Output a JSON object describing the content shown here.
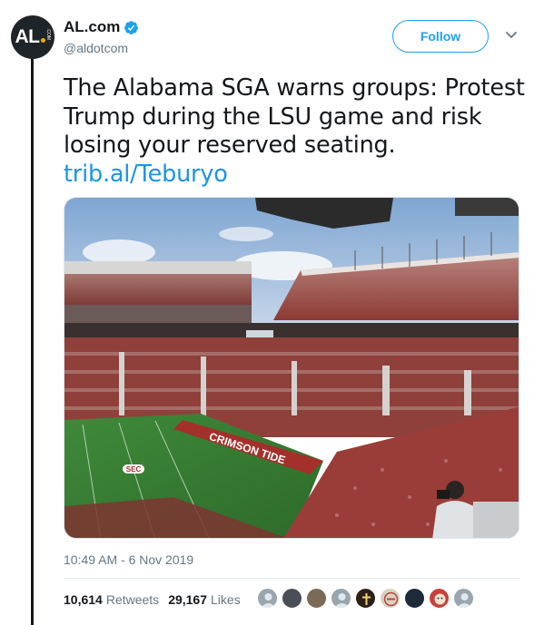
{
  "author": {
    "display_name": "AL.com",
    "handle": "@aldotcom",
    "avatar_text": "AL",
    "avatar_side_text": ".COM",
    "verified": true
  },
  "actions": {
    "follow_label": "Follow"
  },
  "tweet": {
    "text": "The Alabama SGA warns groups: Protest Trump during the LSU game and risk losing your reserved seating.",
    "link": "trib.al/Teburyo",
    "timestamp": "10:49 AM - 6 Nov 2019"
  },
  "media": {
    "field_text": "CRIMSON TIDE",
    "field_logo": "SEC"
  },
  "stats": {
    "retweets_count": "10,614",
    "retweets_label": "Retweets",
    "likes_count": "29,167",
    "likes_label": "Likes"
  },
  "liker_avatars": [
    {
      "name": "default-avatar-icon",
      "color": "#9aa5ae"
    },
    {
      "name": "dark-photo-avatar-icon",
      "color": "#4a4f57"
    },
    {
      "name": "pattern-avatar-icon",
      "color": "#7b6a55"
    },
    {
      "name": "default-avatar-icon",
      "color": "#9aa5ae"
    },
    {
      "name": "cross-avatar-icon",
      "color": "#2b2118"
    },
    {
      "name": "badge-avatar-icon",
      "color": "#d9d2c2"
    },
    {
      "name": "dark-round-avatar-icon",
      "color": "#1e2a3a"
    },
    {
      "name": "lion-avatar-icon",
      "color": "#c8403a"
    },
    {
      "name": "default-avatar-icon",
      "color": "#9aa5ae"
    }
  ],
  "colors": {
    "accent": "#1da1f2",
    "link": "#1b95e0",
    "muted": "#657786",
    "text": "#14171a"
  }
}
